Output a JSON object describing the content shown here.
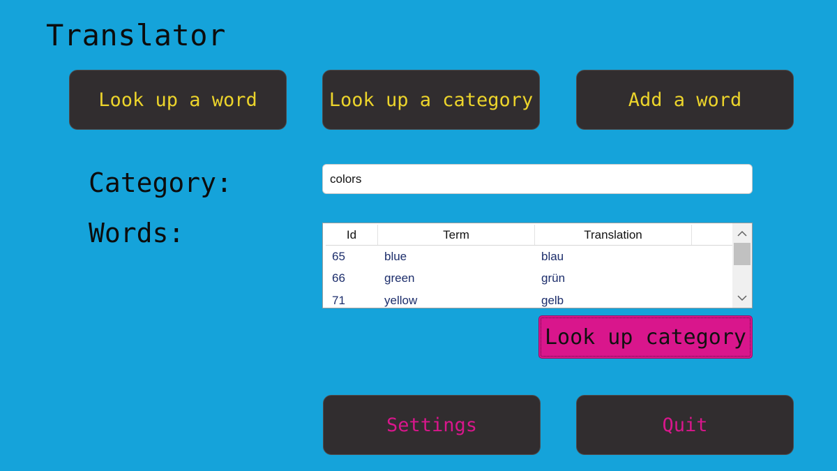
{
  "app": {
    "title": "Translator"
  },
  "nav": {
    "lookup_word": "Look up a word",
    "lookup_category": "Look up a category",
    "add_word": "Add a word"
  },
  "form": {
    "category_label": "Category:",
    "category_value": "colors",
    "words_label": "Words:"
  },
  "table": {
    "columns": [
      "Id",
      "Term",
      "Translation"
    ],
    "rows": [
      {
        "id": "65",
        "term": "blue",
        "translation": "blau"
      },
      {
        "id": "66",
        "term": "green",
        "translation": "grün"
      },
      {
        "id": "71",
        "term": "yellow",
        "translation": "gelb"
      }
    ]
  },
  "actions": {
    "lookup_category": "Look up category",
    "settings": "Settings",
    "quit": "Quit"
  },
  "icons": {
    "scroll_up": "chevron-up-icon",
    "scroll_down": "chevron-down-icon"
  },
  "colors": {
    "background": "#15a3da",
    "button_dark": "#312d2f",
    "nav_text": "#ecd42b",
    "accent_magenta": "#d9168c"
  }
}
